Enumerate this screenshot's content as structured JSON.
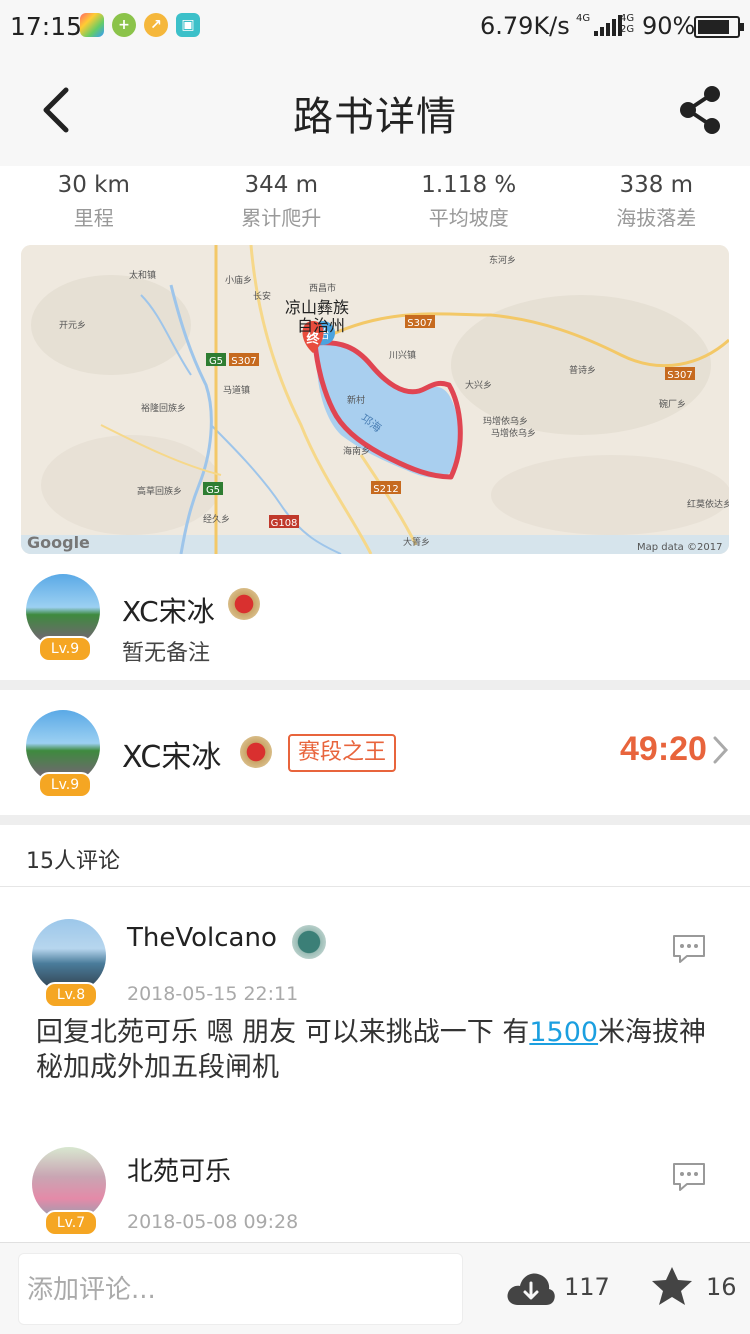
{
  "status_bar": {
    "time": "17:15",
    "net_speed": "6.79K/s",
    "net_type_1": "4G",
    "net_type_2": "4G",
    "net_type_3": "2G",
    "battery": "90%",
    "battery_level": 0.9
  },
  "navbar": {
    "title": "路书详情",
    "back_icon": "chevron-left-icon",
    "share_icon": "share-icon"
  },
  "stats": [
    {
      "value": "30 km",
      "label": "里程"
    },
    {
      "value": "344 m",
      "label": "累计爬升"
    },
    {
      "value": "1.118 %",
      "label": "平均坡度"
    },
    {
      "value": "338 m",
      "label": "海拔落差"
    }
  ],
  "map": {
    "labels": {
      "taihe": "太和镇",
      "xiaomiao": "小庙乡",
      "xichang": "西昌市",
      "donghe": "东河乡",
      "kaiyuan": "开元乡",
      "changan": "长安",
      "city1": "凉山彝族",
      "city2": "自治州",
      "s307a": "S307",
      "s307b": "S307",
      "g5a": "G5",
      "s307c": "S307",
      "g5b": "G5",
      "chuanxing": "川兴镇",
      "puqing": "普诗乡",
      "madao": "马道镇",
      "daxing": "大兴乡",
      "yuhuang": "裕隆回族乡",
      "xincun": "新村",
      "qionghai": "邛海",
      "mazeng1": "玛增依乌乡",
      "mazeng2": "马增依乌乡",
      "wanchang": "碗厂乡",
      "haina": "海南乡",
      "gaocao": "高草回族乡",
      "s212": "S212",
      "jingjiu": "经久乡",
      "g108": "G108",
      "hongmo": "红莫依达乡",
      "dachang": "大箐乡",
      "end_marker": "终",
      "start_marker": "始"
    },
    "google": "Google",
    "copyright": "Map data ©2017",
    "route_color": "#e04552",
    "lake_color": "#a9cfef"
  },
  "author": {
    "name": "XC宋冰",
    "level": "Lv.9",
    "note": "暂无备注"
  },
  "king": {
    "name": "XC宋冰",
    "level": "Lv.9",
    "tag": "赛段之王",
    "time": "49:20"
  },
  "comments_header": "15人评论",
  "comments": [
    {
      "name": "TheVolcano",
      "level": "Lv.8",
      "date": "2018-05-15 22:11",
      "text_before": "回复北苑可乐 嗯 朋友 可以来挑战一下 有",
      "text_num": "1500",
      "text_after": "米海拔神秘加成外加五段闸机"
    },
    {
      "name": "北苑可乐",
      "level": "Lv.7",
      "date": "2018-05-08 09:28"
    }
  ],
  "bottom_bar": {
    "placeholder": "添加评论...",
    "downloads": "117",
    "stars": "16"
  },
  "colors": {
    "accent": "#e8643c",
    "level_badge": "#f5a623",
    "link": "#1b9fe0"
  }
}
